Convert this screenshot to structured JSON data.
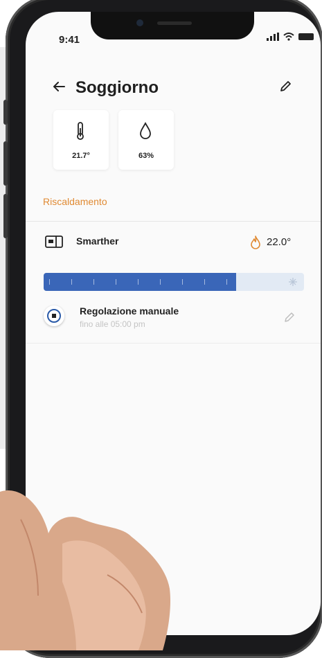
{
  "status_bar": {
    "time": "9:41"
  },
  "header": {
    "title": "Soggiorno"
  },
  "sensors": [
    {
      "name": "temperature",
      "value": "21.7°",
      "icon": "thermometer-icon"
    },
    {
      "name": "humidity",
      "value": "63%",
      "icon": "droplet-icon"
    }
  ],
  "section": {
    "title": "Riscaldamento"
  },
  "device": {
    "name": "Smarther",
    "temperature": "22.0°",
    "icon": "thermostat-device-icon",
    "mode_icon": "flame-icon"
  },
  "slider": {
    "fill_fraction": 0.74
  },
  "mode": {
    "title": "Regolazione manuale",
    "subtitle": "fino alle 05:00 pm"
  },
  "colors": {
    "accent_orange": "#e08a33",
    "slider_fill": "#3a66b8",
    "slider_track": "#e2eaf4",
    "background": "#fafafa"
  }
}
